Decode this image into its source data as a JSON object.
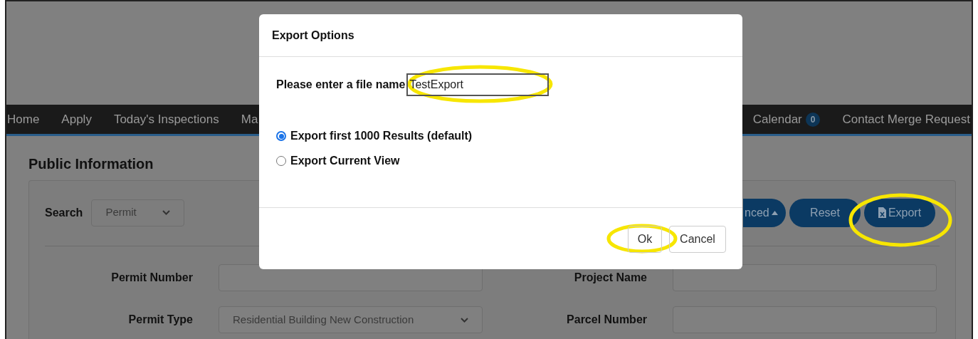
{
  "nav": {
    "items": [
      {
        "label": "Home"
      },
      {
        "label": "Apply"
      },
      {
        "label": "Today's Inspections"
      },
      {
        "label": "Ma"
      }
    ],
    "right_items": [
      {
        "label": "Calendar",
        "badge": "0"
      },
      {
        "label": "Contact Merge Request"
      }
    ]
  },
  "page": {
    "title": "Public Information"
  },
  "search": {
    "label": "Search",
    "value": "Permit",
    "buttons": [
      {
        "kind": "advanced",
        "label": "nced"
      },
      {
        "kind": "plain",
        "label": "Reset"
      },
      {
        "kind": "export",
        "label": "Export"
      }
    ]
  },
  "fields": [
    {
      "label": "Permit Number",
      "kind": "text"
    },
    {
      "label": "Project Name",
      "kind": "text"
    },
    {
      "label": "Permit Type",
      "kind": "select",
      "value": "Residential Building New Construction"
    },
    {
      "label": "Parcel Number",
      "kind": "text"
    }
  ],
  "dialog": {
    "title": "Export Options",
    "filename_label": "Please enter a file name",
    "filename_value": "TestExport",
    "options": [
      {
        "label": "Export first 1000 Results (default)",
        "selected": true
      },
      {
        "label": "Export Current View",
        "selected": false
      }
    ],
    "buttons": [
      {
        "label": "Ok"
      },
      {
        "label": "Cancel"
      }
    ]
  }
}
